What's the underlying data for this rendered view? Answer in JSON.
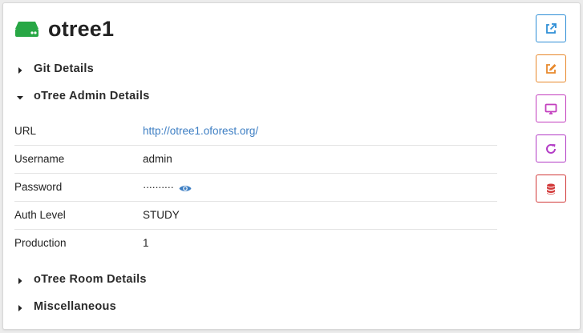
{
  "app": {
    "title": "otree1",
    "brand_color": "#28a745"
  },
  "sections": {
    "git": {
      "label": "Git Details",
      "expanded": false
    },
    "admin": {
      "label": "oTree Admin Details",
      "expanded": true
    },
    "room": {
      "label": "oTree Room Details",
      "expanded": false
    },
    "misc": {
      "label": "Miscellaneous",
      "expanded": false
    }
  },
  "admin_details": {
    "rows": [
      {
        "key": "URL",
        "value": "http://otree1.oforest.org/"
      },
      {
        "key": "Username",
        "value": "admin"
      },
      {
        "key": "Password",
        "value": "··········"
      },
      {
        "key": "Auth Level",
        "value": "STUDY"
      },
      {
        "key": "Production",
        "value": "1"
      }
    ],
    "link_color": "#3d7ec3"
  },
  "actions": [
    {
      "icon": "external-link-icon",
      "color": "#2f8fd6"
    },
    {
      "icon": "edit-icon",
      "color": "#e8892d"
    },
    {
      "icon": "monitor-icon",
      "color": "#c33fbf"
    },
    {
      "icon": "refresh-icon",
      "color": "#b33dc6"
    },
    {
      "icon": "database-icon",
      "color": "#d23a3a"
    }
  ]
}
